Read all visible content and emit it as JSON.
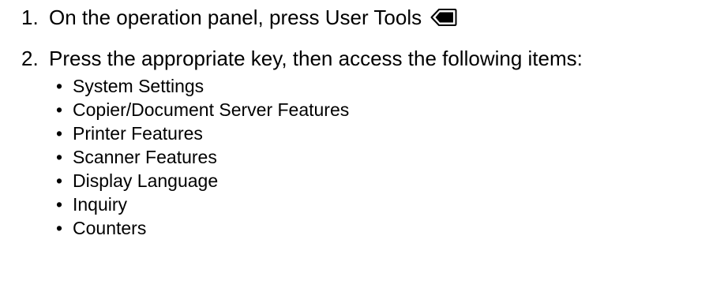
{
  "steps": [
    {
      "number": "1.",
      "text": "On the operation panel, press User Tools",
      "icon": "user-tools-key-icon"
    },
    {
      "number": "2.",
      "text": "Press the appropriate key, then access the following items:"
    }
  ],
  "bullet_symbol": "•",
  "items": [
    "System Settings",
    "Copier/Document Server Features",
    "Printer Features",
    "Scanner Features",
    "Display Language",
    "Inquiry",
    "Counters"
  ]
}
